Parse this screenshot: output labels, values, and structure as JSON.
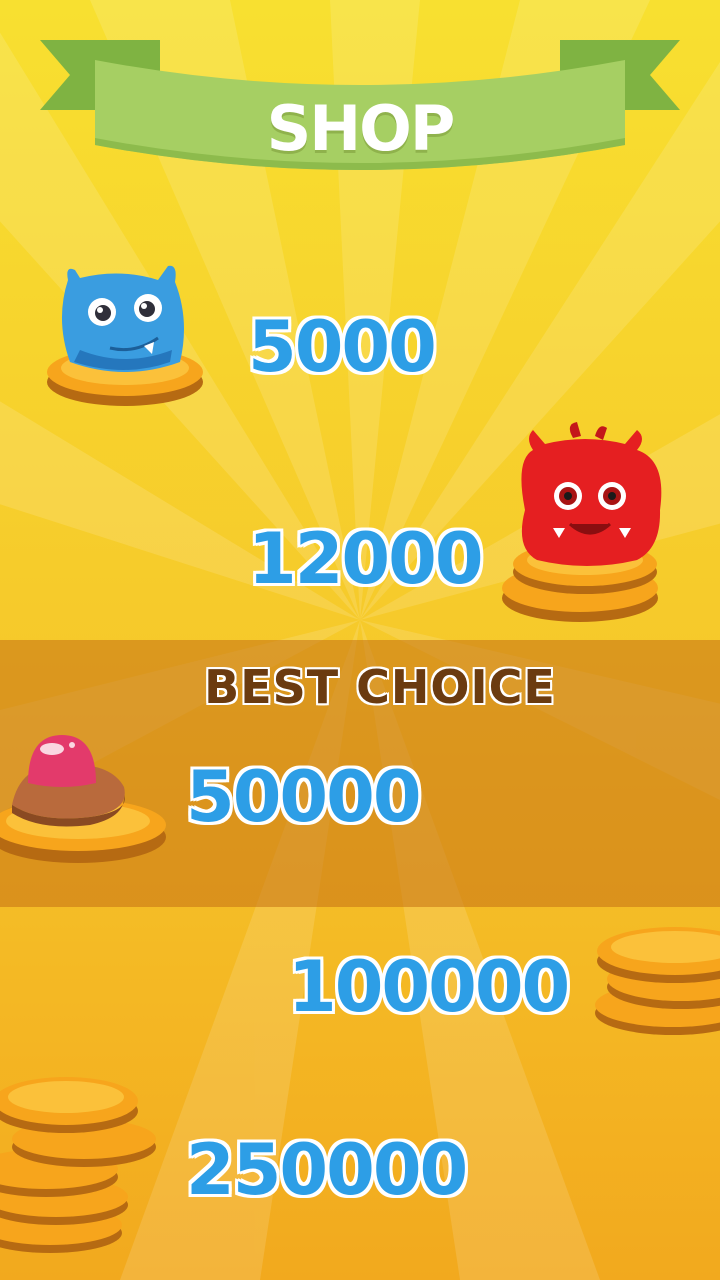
{
  "header": {
    "title": "SHOP"
  },
  "best_choice_label": "BEST CHOICE",
  "items": [
    {
      "price": "5000",
      "icon": "blue-monster-on-coin-icon"
    },
    {
      "price": "12000",
      "icon": "red-monster-on-coins-icon"
    },
    {
      "price": "50000",
      "icon": "pink-jelly-on-coin-icon"
    },
    {
      "price": "100000",
      "icon": "coin-stack-icon"
    },
    {
      "price": "250000",
      "icon": "large-coin-stack-icon"
    }
  ],
  "colors": {
    "background": "#f6c52a",
    "ribbon": "#a6cf63",
    "price_text": "#2d9ee6",
    "best_choice_text": "#6b3b10",
    "coin": "#f7a51c"
  }
}
